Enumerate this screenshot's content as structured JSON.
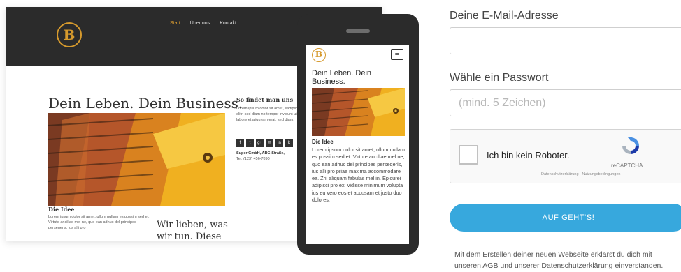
{
  "desktop": {
    "nav": [
      "Start",
      "Über uns",
      "Kontakt"
    ],
    "logo_letter": "B",
    "headline": "Dein Leben. Dein Business.",
    "subheading": "Die Idee",
    "body": "Lorem ipsum dolor sit amet, ullum nullam es possim sed et. Virtute ancillae mel ne, quo ean adhuc del principes perseqeris, ius alli pro",
    "headline2": "Wir lieben, was wir tun. Diese",
    "side_heading": "So findet man uns",
    "side_text": "Lorem ipsum dolor sit amet, sadipscing elitr, sed diam no tempor invidunt ut labore et aliquyam erat, sed diam.",
    "company": "Super GmbH, ABC-Straße,",
    "phone": "Tel: (123) 456-7890",
    "social": [
      "f",
      "t",
      "g+",
      "✉",
      "in",
      "k"
    ]
  },
  "mobile": {
    "logo_letter": "B",
    "title": "Dein Leben. Dein Business.",
    "subheading": "Die Idee",
    "body": "Lorem ipsum dolor sit amet, ullum nullam es possim sed et. Virtute ancillae mel ne, quo ean adhuc del principes perseqeris, ius alli pro priae maxima accommodare ea. Zril aliquam fabulas mel in. Epicurei adipisci pro ex, vidisse minimum volupta ius eu vero eos et accusam et justo duo dolores."
  },
  "form": {
    "email_label": "Deine E-Mail-Adresse",
    "email_value": "",
    "email_placeholder": "",
    "password_label": "Wähle ein Passwort",
    "password_placeholder": "(mind. 5 Zeichen)",
    "captcha_label": "Ich bin kein Roboter.",
    "captcha_brand": "reCAPTCHA",
    "captcha_links": "Datenschutzerklärung - Nutzungsbedingungen",
    "submit_label": "AUF GEHT'S!",
    "legal_prefix": "Mit dem Erstellen deiner neuen Webseite erklärst du dich mit",
    "legal_mid1": "unseren",
    "legal_agb": "AGB",
    "legal_mid2": "und unserer",
    "legal_privacy": "Datenschutzerklärung",
    "legal_suffix": "einverstanden."
  },
  "colors": {
    "accent_gold": "#d69a2d",
    "dark_header": "#2b2b2b",
    "button_blue": "#37a8dd"
  }
}
